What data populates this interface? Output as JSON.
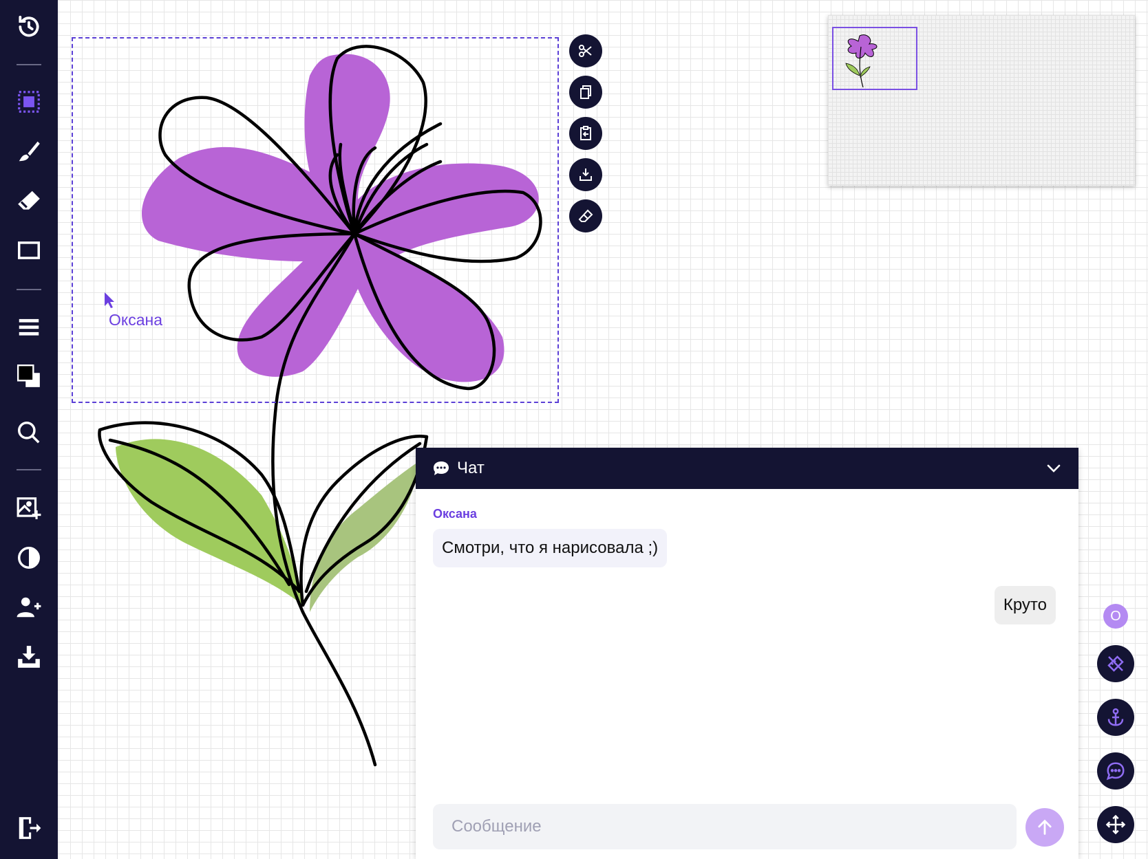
{
  "colors": {
    "sidebar_bg": "#141433",
    "accent": "#6b3fe0",
    "petal": "#b864d6",
    "leaf_light": "#9fcb5d",
    "leaf_dark": "#a8c47e",
    "send_button": "#c9a8f5"
  },
  "sidebar": {
    "tools": [
      {
        "icon": "history-icon",
        "label": "История"
      },
      {
        "icon": "select-icon",
        "label": "Выделение",
        "active": true
      },
      {
        "icon": "brush-icon",
        "label": "Кисть"
      },
      {
        "icon": "eraser-icon",
        "label": "Ластик"
      },
      {
        "icon": "rectangle-icon",
        "label": "Прямоугольник"
      },
      {
        "icon": "line-width-icon",
        "label": "Толщина линии"
      },
      {
        "icon": "color-swatch-icon",
        "label": "Цвета"
      },
      {
        "icon": "zoom-icon",
        "label": "Масштаб"
      },
      {
        "icon": "add-image-icon",
        "label": "Добавить изображение"
      },
      {
        "icon": "contrast-icon",
        "label": "Контраст"
      },
      {
        "icon": "add-user-icon",
        "label": "Пригласить"
      },
      {
        "icon": "download-icon",
        "label": "Скачать"
      },
      {
        "icon": "exit-icon",
        "label": "Выход"
      }
    ]
  },
  "selection_actions": [
    {
      "icon": "scissors-icon"
    },
    {
      "icon": "copy-icon"
    },
    {
      "icon": "paste-icon"
    },
    {
      "icon": "save-selection-icon"
    },
    {
      "icon": "erase-selection-icon"
    }
  ],
  "canvas": {
    "remote_cursor_name": "Оксана"
  },
  "chat": {
    "title": "Чат",
    "messages": [
      {
        "sender": "Оксана",
        "text": "Смотри, что я нарисовала ;)",
        "direction": "incoming"
      },
      {
        "sender": "",
        "text": "Круто",
        "direction": "outgoing"
      }
    ],
    "input_placeholder": "Сообщение",
    "input_value": ""
  },
  "right_controls": {
    "avatar_initial": "О",
    "buttons": [
      {
        "icon": "ruler-pencil-icon"
      },
      {
        "icon": "anchor-icon"
      },
      {
        "icon": "chat-icon"
      },
      {
        "icon": "move-icon"
      }
    ]
  }
}
